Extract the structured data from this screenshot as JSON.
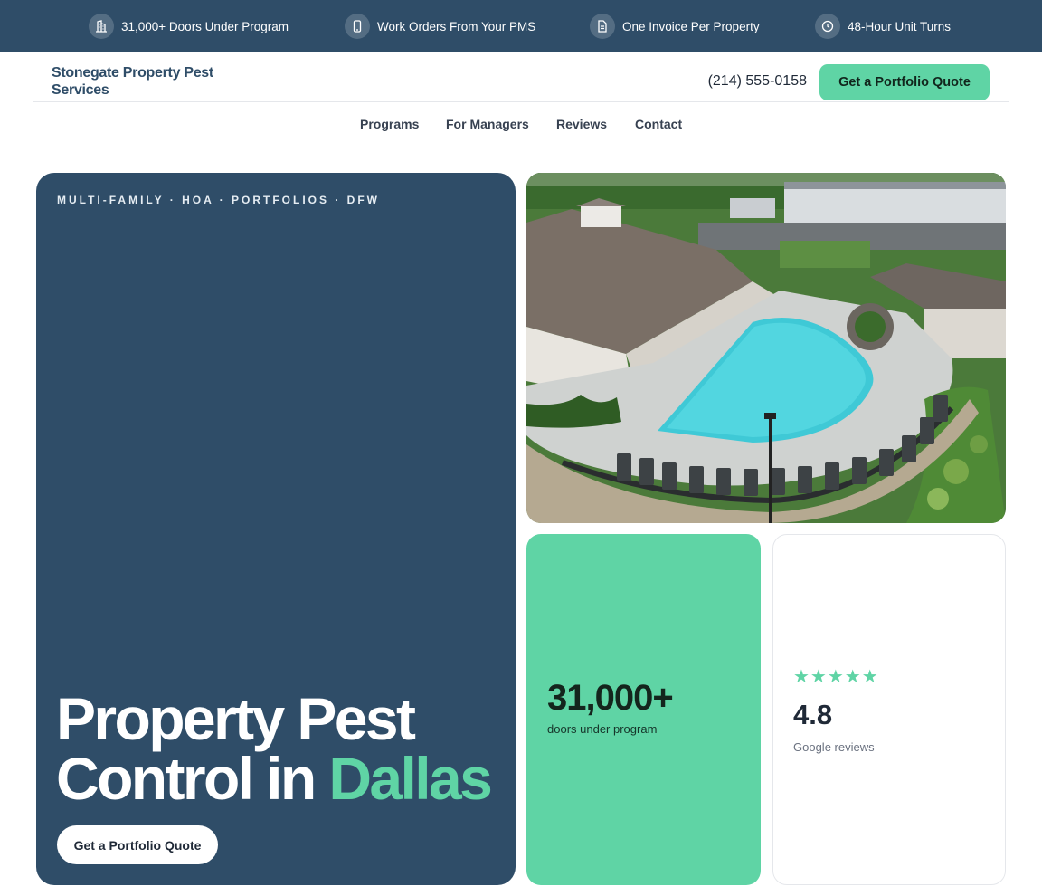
{
  "topbar": {
    "items": [
      {
        "label": "31,000+ Doors Under Program",
        "icon": "building-icon"
      },
      {
        "label": "Work Orders From Your PMS",
        "icon": "phone-icon"
      },
      {
        "label": "One Invoice Per Property",
        "icon": "invoice-icon"
      },
      {
        "label": "48-Hour Unit Turns",
        "icon": "clock-icon"
      }
    ]
  },
  "header": {
    "brand": "Stonegate Property Pest Services",
    "phone": "(214) 555-0158",
    "cta_label": "Get a Portfolio Quote"
  },
  "nav": {
    "items": [
      "Programs",
      "For Managers",
      "Reviews",
      "Contact"
    ]
  },
  "hero": {
    "eyebrow": "MULTI-FAMILY · HOA · PORTFOLIOS · DFW",
    "title_main": "Property Pest Control in ",
    "title_accent": "Dallas",
    "cta_label": "Get a Portfolio Quote"
  },
  "stats": {
    "doors_value": "31,000+",
    "doors_label": "doors under program"
  },
  "reviews": {
    "stars": "★★★★★",
    "rating": "4.8",
    "label": "Google reviews"
  },
  "colors": {
    "brand_navy": "#2f4d68",
    "accent_mint": "#5fd4a5"
  }
}
